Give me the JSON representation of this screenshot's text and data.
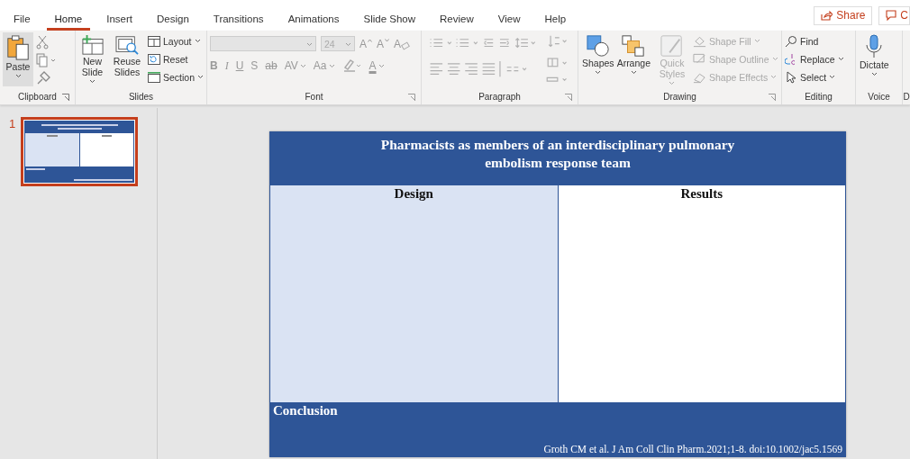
{
  "menu_tabs": [
    {
      "label": "File",
      "selected": false
    },
    {
      "label": "Home",
      "selected": true
    },
    {
      "label": "Insert",
      "selected": false
    },
    {
      "label": "Design",
      "selected": false
    },
    {
      "label": "Transitions",
      "selected": false
    },
    {
      "label": "Animations",
      "selected": false
    },
    {
      "label": "Slide Show",
      "selected": false
    },
    {
      "label": "Review",
      "selected": false
    },
    {
      "label": "View",
      "selected": false
    },
    {
      "label": "Help",
      "selected": false
    }
  ],
  "share_button": {
    "label": "Share"
  },
  "comments_button": {
    "label": "C"
  },
  "ribbon": {
    "clipboard": {
      "label": "Clipboard",
      "paste": "Paste"
    },
    "slides": {
      "label": "Slides",
      "new_slide": "New Slide",
      "reuse_slides": "Reuse Slides",
      "layout": "Layout",
      "reset": "Reset",
      "section": "Section"
    },
    "font": {
      "label": "Font",
      "disabled": true,
      "font_size": "24",
      "row1": [
        {
          "label": "A",
          "kind": "grow"
        },
        {
          "label": "A",
          "kind": "shrink"
        },
        {
          "label": "A",
          "kind": "clear"
        }
      ],
      "row2": [
        {
          "label": "B",
          "kind": "bold"
        },
        {
          "label": "I",
          "kind": "italic"
        },
        {
          "label": "U",
          "kind": "underline"
        },
        {
          "label": "S",
          "kind": "shadow"
        },
        {
          "label": "ab",
          "kind": "strike"
        },
        {
          "label": "AV",
          "kind": "spacing"
        },
        {
          "label": "Aa",
          "kind": "case"
        },
        {
          "label": "A",
          "kind": "color"
        }
      ]
    },
    "paragraph": {
      "label": "Paragraph",
      "disabled": true
    },
    "drawing": {
      "label": "Drawing",
      "large": [
        {
          "label": "Shapes",
          "disabled": false
        },
        {
          "label": "Arrange",
          "disabled": false
        },
        {
          "label": "Quick Styles",
          "disabled": true
        }
      ],
      "small": [
        {
          "label": "Shape Fill",
          "disabled": true
        },
        {
          "label": "Shape Outline",
          "disabled": true
        },
        {
          "label": "Shape Effects",
          "disabled": true
        }
      ]
    },
    "editing": {
      "label": "Editing",
      "items": [
        {
          "label": "Find"
        },
        {
          "label": "Replace"
        },
        {
          "label": "Select"
        }
      ]
    },
    "voice": {
      "label": "Voice",
      "dictate": "Dictate"
    },
    "next_group": {
      "label": "D"
    }
  },
  "thumbnails": [
    {
      "number": "1",
      "selected": true
    }
  ],
  "slide": {
    "title": "Pharmacists as members of an interdisciplinary pulmonary embolism response team",
    "columns": [
      {
        "heading": "Design"
      },
      {
        "heading": "Results"
      }
    ],
    "conclusion": "Conclusion",
    "citation": "Groth CM et al. J Am Coll Clin Pharm.2021;1-8. doi:10.1002/jac5.1569"
  }
}
